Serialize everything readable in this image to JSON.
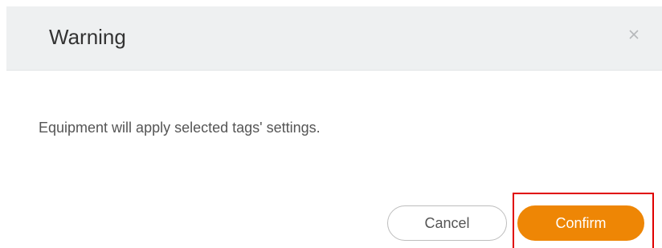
{
  "dialog": {
    "title": "Warning",
    "close_icon": "close-icon",
    "message": "Equipment will apply selected tags' settings.",
    "cancel_label": "Cancel",
    "confirm_label": "Confirm"
  },
  "colors": {
    "header_bg": "#eef0f1",
    "accent": "#ee8605",
    "highlight": "#e00000",
    "text_primary": "#333333",
    "text_secondary": "#555555"
  }
}
